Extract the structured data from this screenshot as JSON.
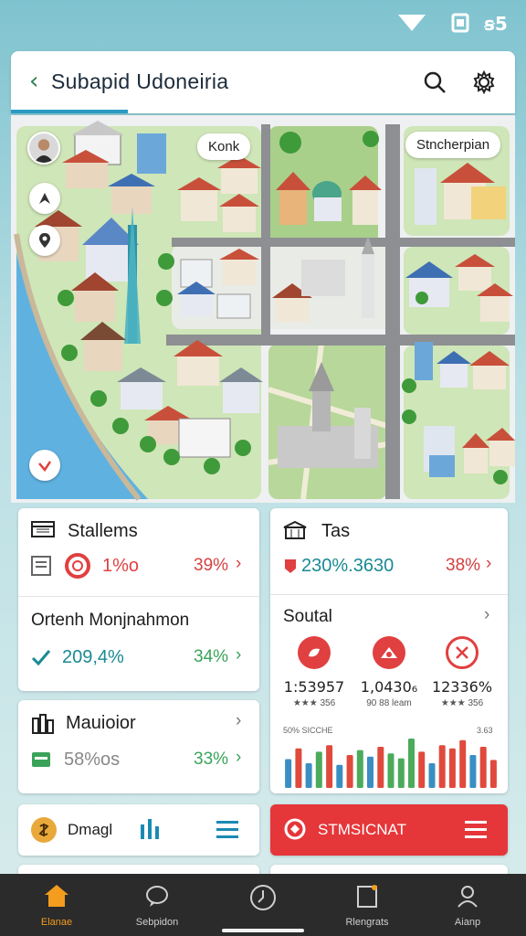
{
  "app": {
    "title": "Subapid Udoneiria",
    "colors": {
      "accent": "#2b9bc4",
      "green": "#3aa35a",
      "red": "#e04040",
      "teal": "#1a8a94",
      "danger_bg": "#e5363a"
    }
  },
  "map": {
    "pill_left": "Konk",
    "pill_right": "Stncherpian"
  },
  "cards": {
    "stallems": {
      "title": "Stallems",
      "value": "1%o",
      "pct": "39%"
    },
    "tas": {
      "title": "Tas",
      "value": "230%.3630",
      "pct": "38%"
    },
    "orteh": {
      "title": "Ortenh Monjnahmon",
      "value": "209,4%",
      "pct": "34%"
    },
    "social": {
      "title": "Soutal",
      "stats": [
        {
          "num": "1:53957",
          "sub": "★★★ 356"
        },
        {
          "num": "1,0430₆",
          "sub": "90 88 leam"
        },
        {
          "num": "12336%",
          "sub": "★★★ 356"
        }
      ],
      "chart_left_label": "50% SICCHE",
      "chart_right_label": "3.63"
    },
    "mauioior": {
      "title": "Mauioior",
      "value": "58%os",
      "pct": "33%"
    },
    "dmagl": {
      "title": "Dmagl"
    },
    "stmsicnat": {
      "title": "STMSICNAT"
    }
  },
  "chart_data": {
    "type": "bar",
    "values": [
      35,
      48,
      30,
      44,
      52,
      28,
      40,
      46,
      38,
      50,
      42,
      36,
      60,
      44,
      30,
      52,
      48,
      58,
      40,
      50,
      34
    ],
    "colors": [
      "#3a8fc2",
      "#e04a3c",
      "#3a8fc2",
      "#4bab5b",
      "#e04a3c",
      "#3a8fc2",
      "#e04a3c",
      "#4bab5b",
      "#3a8fc2",
      "#e04a3c",
      "#4bab5b",
      "#4bab5b",
      "#4bab5b",
      "#e04a3c",
      "#3a8fc2",
      "#e04a3c",
      "#e04a3c",
      "#e04a3c",
      "#3a8fc2",
      "#e04a3c",
      "#e04a3c"
    ]
  },
  "nav": [
    {
      "label": "Elanae",
      "icon": "home-icon",
      "active": true
    },
    {
      "label": "Sebpidon",
      "icon": "chat-icon",
      "active": false
    },
    {
      "label": "",
      "icon": "clock-icon",
      "active": false
    },
    {
      "label": "Rlengrats",
      "icon": "document-icon",
      "active": false
    },
    {
      "label": "Aianp",
      "icon": "profile-icon",
      "active": false
    }
  ]
}
